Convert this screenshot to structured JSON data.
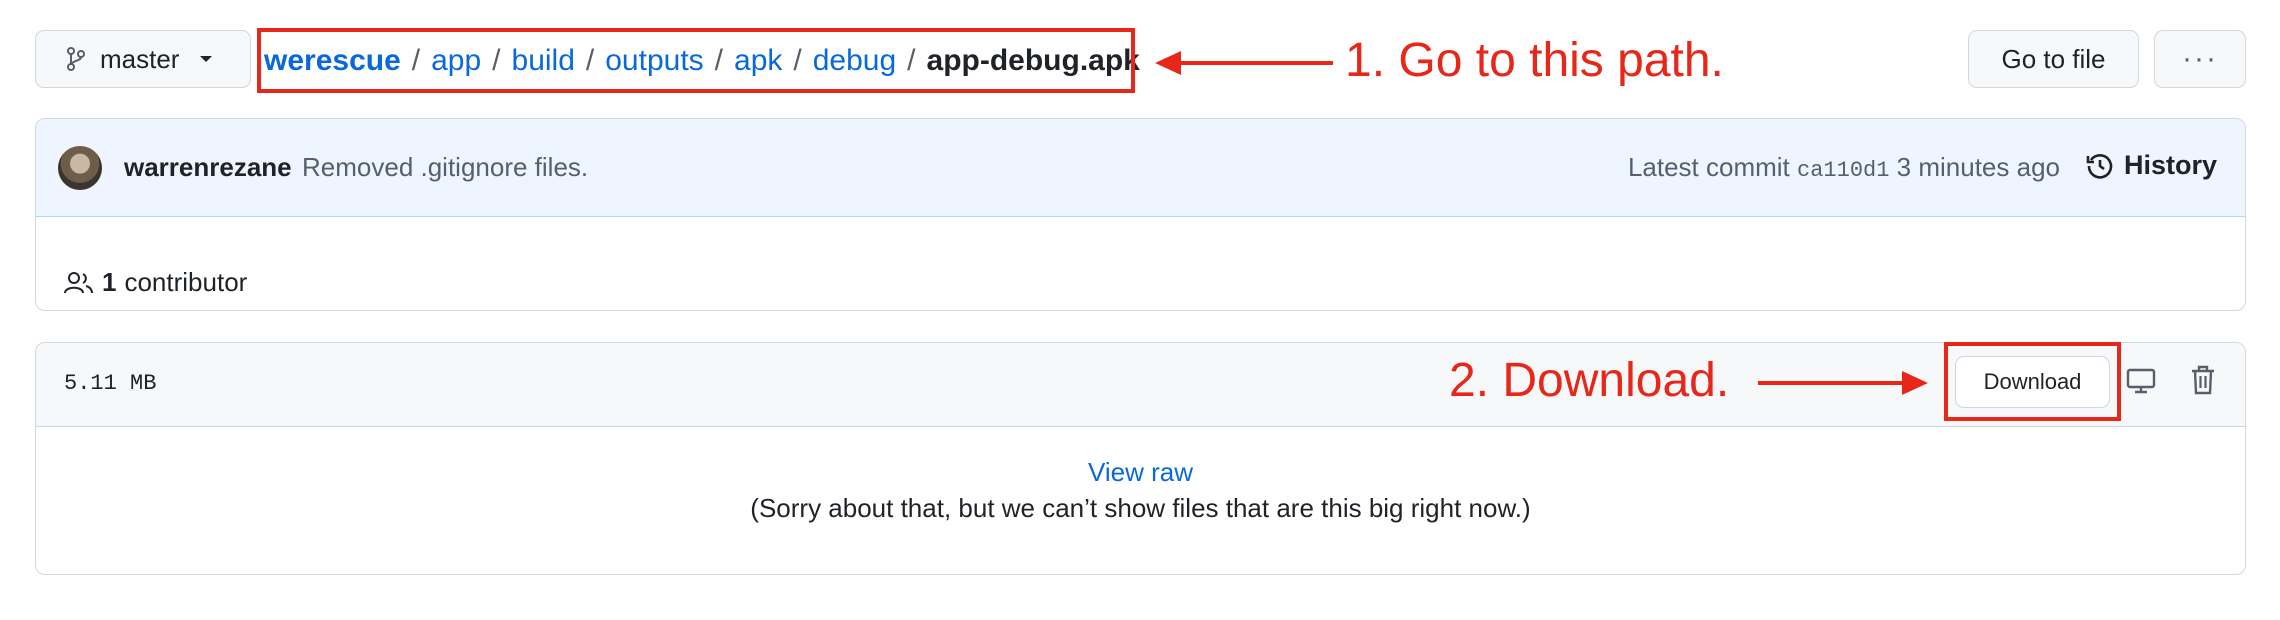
{
  "branch": {
    "label": "master"
  },
  "breadcrumb": {
    "root": "werescue",
    "separator": "/",
    "segments": [
      "app",
      "build",
      "outputs",
      "apk",
      "debug"
    ],
    "current": "app-debug.apk"
  },
  "annotations": {
    "step1": "1. Go to this path.",
    "step2": "2. Download."
  },
  "toolbar": {
    "go_to_file": "Go to file",
    "more_options": "···"
  },
  "commit": {
    "author": "warrenrezane",
    "message": "Removed .gitignore files.",
    "latest_label": "Latest commit",
    "sha": "ca110d1",
    "time": "3 minutes ago",
    "history_label": "History"
  },
  "contributors": {
    "count": "1",
    "label": "contributor"
  },
  "file": {
    "size": "5.11 MB",
    "download_label": "Download",
    "view_raw": "View raw",
    "too_big_message": "(Sorry about that, but we can’t show files that are this big right now.)"
  },
  "colors": {
    "annotation": "#e8271b",
    "link": "#0969da",
    "commit_bar": "#eef5ff",
    "border": "#d0d7de"
  }
}
